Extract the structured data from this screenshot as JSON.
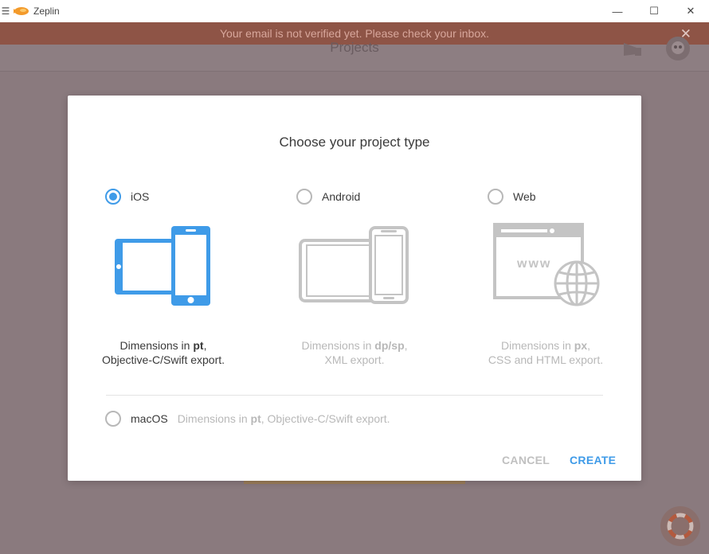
{
  "window": {
    "app_title": "Zeplin",
    "menu_icon": "hamburger-icon",
    "minimize_glyph": "—",
    "maximize_glyph": "☐",
    "close_glyph": "✕"
  },
  "banner": {
    "message": "Your email is not verified yet. Please check your inbox.",
    "close_glyph": "✕"
  },
  "background": {
    "page_title": "Projects"
  },
  "modal": {
    "title": "Choose your project type",
    "options": [
      {
        "label": "iOS",
        "selected": true,
        "desc_pre": "Dimensions in ",
        "desc_unit": "pt",
        "desc_post": ",",
        "desc_line2": "Objective-C/Swift export."
      },
      {
        "label": "Android",
        "selected": false,
        "desc_pre": "Dimensions in ",
        "desc_unit": "dp/sp",
        "desc_post": ",",
        "desc_line2": "XML export."
      },
      {
        "label": "Web",
        "selected": false,
        "desc_pre": "Dimensions in ",
        "desc_unit": "px",
        "desc_post": ",",
        "desc_line2": "CSS and HTML export."
      }
    ],
    "macos": {
      "label": "macOS",
      "selected": false,
      "desc_pre": "Dimensions in ",
      "desc_unit": "pt",
      "desc_post": ", Objective-C/Swift export."
    },
    "web_text": "www",
    "cancel_label": "CANCEL",
    "create_label": "CREATE"
  },
  "colors": {
    "accent": "#3f9be8",
    "banner": "#8e5446",
    "inactive": "#b8b8b8"
  }
}
